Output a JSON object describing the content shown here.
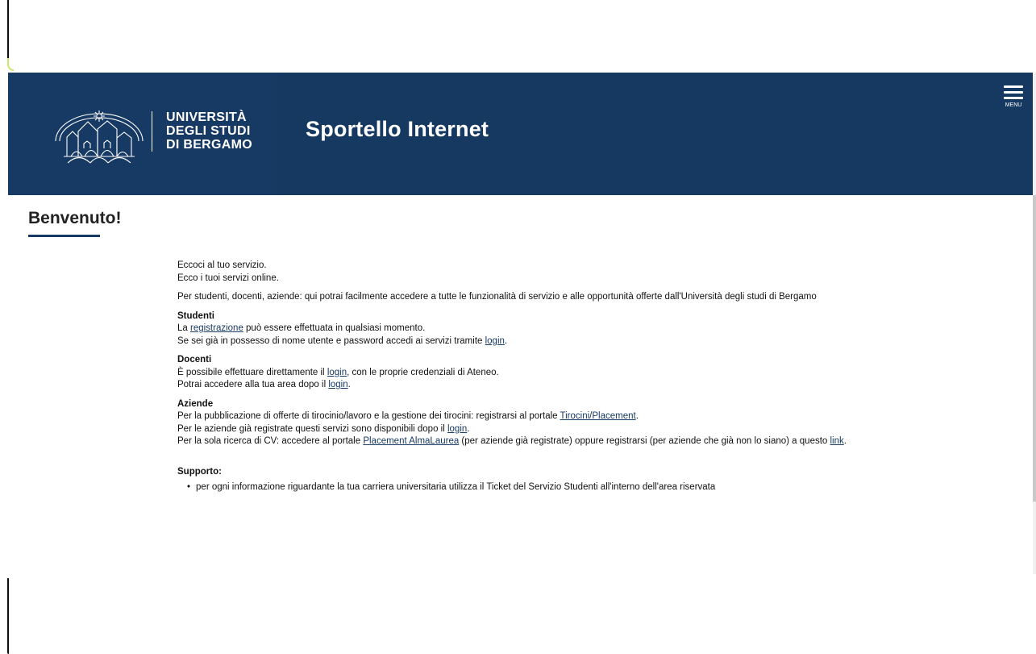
{
  "header": {
    "university_lines": [
      "UNIVERSITÀ",
      "DEGLI STUDI",
      "DI BERGAMO"
    ],
    "site_title": "Sportello Internet",
    "menu_label": "MENU"
  },
  "page": {
    "title": "Benvenuto!"
  },
  "intro": {
    "line1": "Eccoci al tuo servizio.",
    "line2": "Ecco i tuoi servizi online.",
    "description": "Per studenti, docenti, aziende: qui potrai facilmente accedere a tutte le funzionalità di servizio e alle opportunità offerte dall'Università degli studi di Bergamo"
  },
  "studenti": {
    "heading": "Studenti",
    "text1a": "La ",
    "text1_link": "registrazione",
    "text1b": " può essere effettuata in qualsiasi momento.",
    "text2a": "Se sei già in possesso di nome utente e password accedi ai servizi tramite ",
    "text2_link": "login",
    "text2b": "."
  },
  "docenti": {
    "heading": "Docenti",
    "text1a": "È possibile effettuare direttamente il ",
    "text1_link": "login",
    "text1b": ", con le proprie credenziali di Ateneo.",
    "text2a": "Potrai accedere alla tua area dopo il ",
    "text2_link": "login",
    "text2b": "."
  },
  "aziende": {
    "heading": "Aziende",
    "text1a": "Per la pubblicazione di offerte di tirocinio/lavoro e la gestione dei tirocini: registrarsi al portale ",
    "text1_link": "Tirocini/Placement",
    "text1b": ".",
    "text2a": "Per le aziende già registrate questi servizi sono disponibili dopo il ",
    "text2_link": "login",
    "text2b": ".",
    "text3a": "Per la sola ricerca di CV: accedere al portale ",
    "text3_link": "Placement AlmaLaurea",
    "text3b": " (per aziende già registrate) oppure registrarsi (per aziende che già non lo siano) a questo ",
    "text3_link2": "link",
    "text3c": "."
  },
  "support": {
    "heading": "Supporto:",
    "items": [
      "per ogni informazione riguardante la tua carriera universitaria utilizza il Ticket del Servizio Studenti all'interno dell'area riservata"
    ]
  },
  "colors": {
    "header_bg": "#173a64",
    "link": "#173a64"
  }
}
